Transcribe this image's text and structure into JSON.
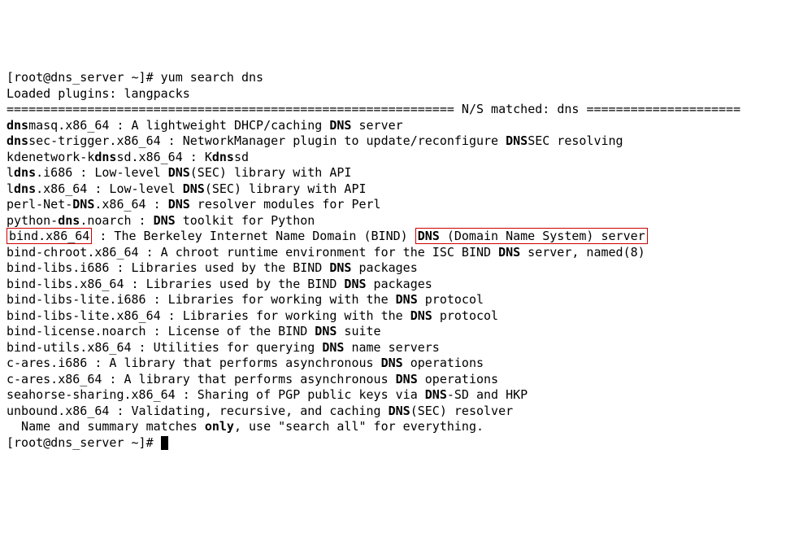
{
  "prompt_user": "[root@dns_server ~]# ",
  "command": "yum search dns",
  "loaded_plugins": "Loaded plugins: langpacks",
  "sep_left": "============================================================= ",
  "sep_label": "N/S matched: dns",
  "sep_right": " =====================",
  "results": [
    {
      "pre": "",
      "bold1": "dns",
      "mid1": "masq.x86_64 : A lightweight DHCP/caching ",
      "bold2": "DNS",
      "mid2": " server",
      "bold3": "",
      "mid3": ""
    },
    {
      "pre": "",
      "bold1": "dns",
      "mid1": "sec-trigger.x86_64 : NetworkManager plugin to update/reconfigure ",
      "bold2": "DNS",
      "mid2": "SEC resolving",
      "bold3": "",
      "mid3": ""
    },
    {
      "pre": "kdenetwork-k",
      "bold1": "dns",
      "mid1": "sd.x86_64 : K",
      "bold2": "dns",
      "mid2": "sd",
      "bold3": "",
      "mid3": ""
    },
    {
      "pre": "l",
      "bold1": "dns",
      "mid1": ".i686 : Low-level ",
      "bold2": "DNS",
      "mid2": "(SEC) library with API",
      "bold3": "",
      "mid3": ""
    },
    {
      "pre": "l",
      "bold1": "dns",
      "mid1": ".x86_64 : Low-level ",
      "bold2": "DNS",
      "mid2": "(SEC) library with API",
      "bold3": "",
      "mid3": ""
    },
    {
      "pre": "perl-Net-",
      "bold1": "DNS",
      "mid1": ".x86_64 : ",
      "bold2": "DNS",
      "mid2": " resolver modules for Perl",
      "bold3": "",
      "mid3": ""
    },
    {
      "pre": "python-",
      "bold1": "dns",
      "mid1": ".noarch : ",
      "bold2": "DNS",
      "mid2": " toolkit for Python",
      "bold3": "",
      "mid3": ""
    }
  ],
  "highlighted": {
    "pkg": "bind.x86_64",
    "sep": " : The Berkeley Internet Name Domain (BIND) ",
    "bold": "DNS",
    "tail": " (Domain Name System) server"
  },
  "results2": [
    {
      "pre": "bind-chroot.x86_64 : A chroot runtime environment for the ISC BIND ",
      "bold1": "DNS",
      "mid1": " server, named(8)",
      "bold2": "",
      "mid2": "",
      "bold3": "",
      "mid3": ""
    },
    {
      "pre": "bind-libs.i686 : Libraries used by the BIND ",
      "bold1": "DNS",
      "mid1": " packages",
      "bold2": "",
      "mid2": "",
      "bold3": "",
      "mid3": ""
    },
    {
      "pre": "bind-libs.x86_64 : Libraries used by the BIND ",
      "bold1": "DNS",
      "mid1": " packages",
      "bold2": "",
      "mid2": "",
      "bold3": "",
      "mid3": ""
    },
    {
      "pre": "bind-libs-lite.i686 : Libraries for working with the ",
      "bold1": "DNS",
      "mid1": " protocol",
      "bold2": "",
      "mid2": "",
      "bold3": "",
      "mid3": ""
    },
    {
      "pre": "bind-libs-lite.x86_64 : Libraries for working with the ",
      "bold1": "DNS",
      "mid1": " protocol",
      "bold2": "",
      "mid2": "",
      "bold3": "",
      "mid3": ""
    },
    {
      "pre": "bind-license.noarch : License of the BIND ",
      "bold1": "DNS",
      "mid1": " suite",
      "bold2": "",
      "mid2": "",
      "bold3": "",
      "mid3": ""
    },
    {
      "pre": "bind-utils.x86_64 : Utilities for querying ",
      "bold1": "DNS",
      "mid1": " name servers",
      "bold2": "",
      "mid2": "",
      "bold3": "",
      "mid3": ""
    },
    {
      "pre": "c-ares.i686 : A library that performs asynchronous ",
      "bold1": "DNS",
      "mid1": " operations",
      "bold2": "",
      "mid2": "",
      "bold3": "",
      "mid3": ""
    },
    {
      "pre": "c-ares.x86_64 : A library that performs asynchronous ",
      "bold1": "DNS",
      "mid1": " operations",
      "bold2": "",
      "mid2": "",
      "bold3": "",
      "mid3": ""
    },
    {
      "pre": "seahorse-sharing.x86_64 : Sharing of PGP public keys via ",
      "bold1": "DNS",
      "mid1": "-SD and HKP",
      "bold2": "",
      "mid2": "",
      "bold3": "",
      "mid3": ""
    },
    {
      "pre": "unbound.x86_64 : Validating, recursive, and caching ",
      "bold1": "DNS",
      "mid1": "(SEC) resolver",
      "bold2": "",
      "mid2": "",
      "bold3": "",
      "mid3": ""
    }
  ],
  "footer_pre": "  Name and summary matches ",
  "footer_bold": "only",
  "footer_post": ", use \"search all\" for everything.",
  "prompt2": "[root@dns_server ~]# "
}
